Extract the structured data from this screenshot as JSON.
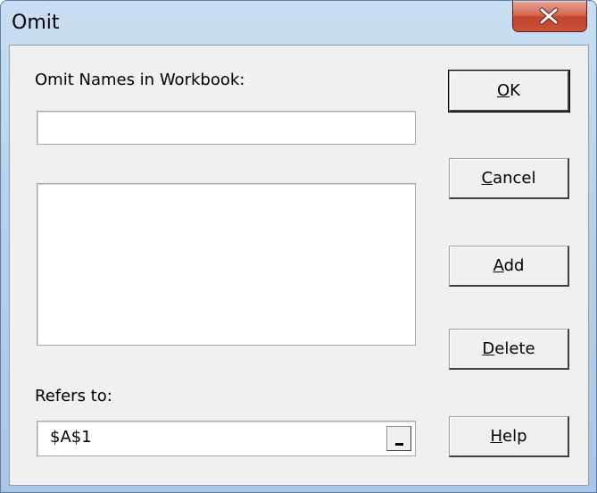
{
  "window": {
    "title": "Omit"
  },
  "form": {
    "names_label": "Omit Names in Workbook:",
    "name_value": "",
    "refers_label": "Refers to:",
    "refers_value": "$A$1"
  },
  "buttons": {
    "ok": {
      "mnemonic": "O",
      "rest": "K"
    },
    "cancel": {
      "mnemonic": "C",
      "rest": "ancel"
    },
    "add": {
      "mnemonic": "A",
      "rest": "dd"
    },
    "delete": {
      "mnemonic": "D",
      "rest": "elete"
    },
    "help": {
      "mnemonic": "H",
      "rest": "elp"
    }
  },
  "icons": {
    "close": "close-icon",
    "collapse": "collapse-dialog-icon"
  }
}
